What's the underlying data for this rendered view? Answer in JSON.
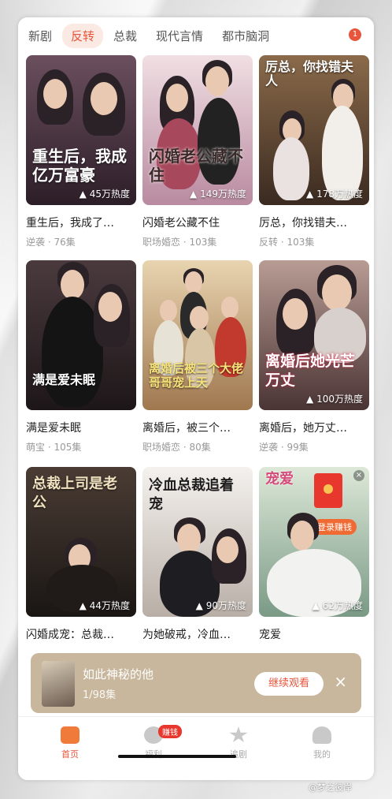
{
  "tabs": [
    "新剧",
    "反转",
    "总裁",
    "现代言情",
    "都市脑洞"
  ],
  "active_tab": "反转",
  "tab_badge": "1",
  "cards": [
    {
      "title": "重生后，我成了…",
      "meta": "逆袭 · 76集",
      "heat": "45万热度",
      "poster_text": "重生后，我成亿万富豪",
      "bg": "#3b2a3c"
    },
    {
      "title": "闪婚老公藏不住",
      "meta": "职场婚恋 · 103集",
      "heat": "149万热度",
      "poster_text": "闪婚老公藏不住",
      "bg": "#c9a6b4"
    },
    {
      "title": "厉总，你找错夫…",
      "meta": "反转 · 103集",
      "heat": "178万热度",
      "poster_text": "厉总，你找错夫人",
      "bg": "#5a3e2e"
    },
    {
      "title": "满是爱未眠",
      "meta": "萌宝 · 105集",
      "heat": "",
      "poster_text": "满是爱未眠",
      "bg": "#2e2429"
    },
    {
      "title": "离婚后，被三个…",
      "meta": "职场婚恋 · 80集",
      "heat": "",
      "poster_text": "离婚后被三个大佬哥哥宠上天",
      "bg": "#c8a57a"
    },
    {
      "title": "离婚后，她万丈…",
      "meta": "逆袭 · 99集",
      "heat": "100万热度",
      "poster_text": "离婚后她光芒万丈",
      "bg": "#5c4848"
    },
    {
      "title": "闪婚成宠：总裁…",
      "meta": "",
      "heat": "44万热度",
      "poster_text": "总裁上司是老公",
      "bg": "#2d2523"
    },
    {
      "title": "为她破戒，冷血…",
      "meta": "",
      "heat": "90万热度",
      "poster_text": "冷血总裁追着宠",
      "bg": "#d9d3cf"
    },
    {
      "title": "宠爱",
      "meta": "",
      "heat": "62万热度",
      "poster_text": "宠爱",
      "bg": "#b7cbb9"
    }
  ],
  "red_envelope": {
    "label": "登录赚钱",
    "close": "×"
  },
  "mini_player": {
    "title": "如此神秘的他",
    "episode": "1/98集",
    "button": "继续观看",
    "close": "×"
  },
  "bottom_nav": [
    {
      "label": "首页",
      "icon": "home-icon"
    },
    {
      "label": "福利",
      "icon": "welfare-icon"
    },
    {
      "label": "追剧",
      "icon": "star-icon"
    },
    {
      "label": "我的",
      "icon": "profile-icon"
    }
  ],
  "earn_badge": "赚钱",
  "watermark": "@梦之彼岸",
  "colors": {
    "accent": "#e8553a",
    "heat_text": "#ffffff"
  }
}
